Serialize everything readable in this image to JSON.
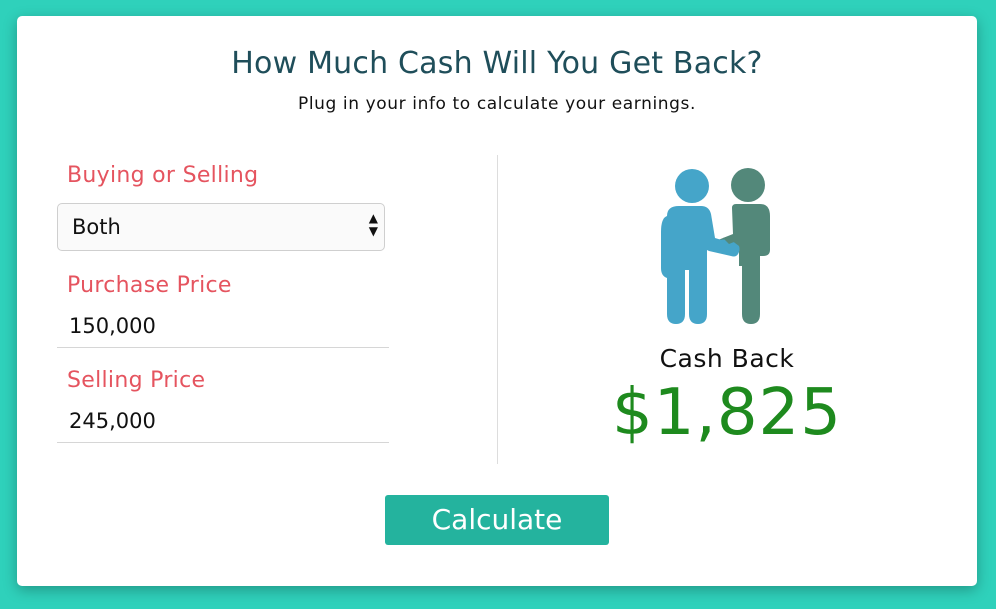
{
  "header": {
    "title": "How Much Cash Will You Get Back?",
    "subtitle": "Plug in your info to calculate your earnings."
  },
  "form": {
    "buying_selling": {
      "label": "Buying or Selling",
      "selected": "Both"
    },
    "purchase_price": {
      "label": "Purchase Price",
      "value": "150,000"
    },
    "selling_price": {
      "label": "Selling Price",
      "value": "245,000"
    }
  },
  "result": {
    "icon": "handshake-icon",
    "label": "Cash Back",
    "amount": "$1,825"
  },
  "actions": {
    "calculate_label": "Calculate"
  },
  "colors": {
    "background": "#2fd1bb",
    "title": "#1f4e5a",
    "label": "#e5545f",
    "amount": "#1e8a1e",
    "button": "#24b39e",
    "person_left": "#45a5c9",
    "person_right": "#53887a"
  }
}
